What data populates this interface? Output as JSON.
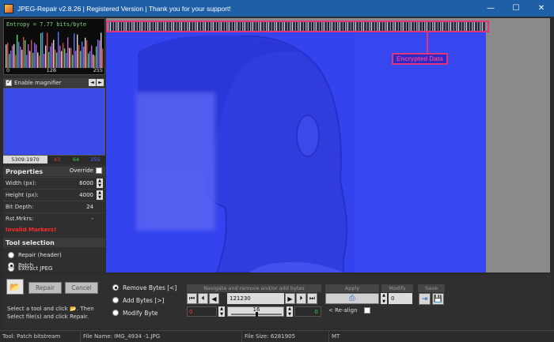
{
  "titlebar": {
    "title": "JPEG-Repair v2.8.26 | Registered Version | Thank you for your support!",
    "minimize": "—",
    "maximize": "☐",
    "close": "✕"
  },
  "histogram": {
    "entropy_label": "Entropy = 7.77 bits/byte",
    "tick_min": "0",
    "tick_mid": "128",
    "tick_max": "255"
  },
  "magnifier": {
    "label": "Enable magnifier",
    "checked": true,
    "left_arrow": "◄",
    "right_arrow": "►",
    "coords": "5309:1970",
    "r": "43",
    "g": "64",
    "b": "255"
  },
  "properties": {
    "title": "Properties",
    "override_label": "Override",
    "width_label": "Width (px):",
    "width_value": "6000",
    "height_label": "Height (px):",
    "height_value": "4000",
    "bitdepth_label": "Bit Depth:",
    "bitdepth_value": "24",
    "rst_label": "Rst.Mrkrs:",
    "rst_value": "-",
    "invalid_label": "Invalid Markers!"
  },
  "tool_selection": {
    "title": "Tool selection",
    "options": [
      "Repair (header)",
      "Extract JPEG",
      "Patch"
    ],
    "selected": "Patch"
  },
  "viewer": {
    "annotation": "Encrypted Data",
    "accent_color": "#e0357a"
  },
  "actions": {
    "repair": "Repair",
    "cancel": "Cancel",
    "help": "Select a tool and click 📂. Then Select file(s) and click Repair."
  },
  "patch_modes": {
    "options": [
      "Remove Bytes [<]",
      "Add Bytes [>]",
      "Modify Byte"
    ],
    "selected": "Remove Bytes [<]"
  },
  "navigate": {
    "section_label": "Navigate and remove and/or add bytes",
    "offset": "121230",
    "left_value": "0",
    "slider_value": "16",
    "slider_fraction": 0.5,
    "right_value": "0",
    "realign_label": "< Re-align"
  },
  "apply": {
    "section_label": "Apply"
  },
  "modify": {
    "section_label": "Modify",
    "value": "0"
  },
  "save": {
    "section_label": "Save"
  },
  "statusbar": {
    "tool": "Tool: Patch bitstream",
    "file_name": "File Name: IMG_4934 -1.JPG",
    "file_size": "File Size: 6281905",
    "mode": "MT"
  }
}
